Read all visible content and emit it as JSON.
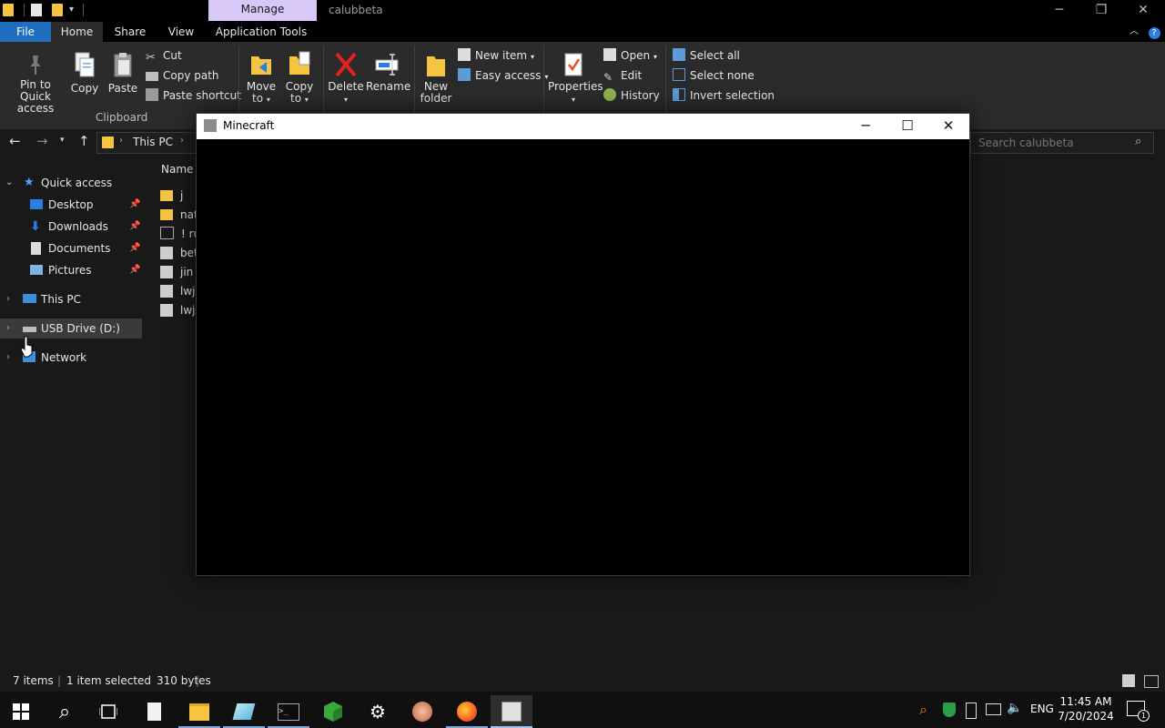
{
  "titlebar": {
    "manage_tab": "Manage",
    "window_title": "calubbeta"
  },
  "tabs": {
    "file": "File",
    "home": "Home",
    "share": "Share",
    "view": "View",
    "application_tools": "Application Tools"
  },
  "ribbon": {
    "pin_to_quick_access_line1": "Pin to Quick",
    "pin_to_quick_access_line2": "access",
    "copy": "Copy",
    "paste": "Paste",
    "cut": "Cut",
    "copy_path": "Copy path",
    "paste_shortcut": "Paste shortcut",
    "clipboard_group": "Clipboard",
    "move_to_line1": "Move",
    "move_to_line2": "to",
    "copy_to_line1": "Copy",
    "copy_to_line2": "to",
    "delete": "Delete",
    "rename": "Rename",
    "new_folder_line1": "New",
    "new_folder_line2": "folder",
    "new_item": "New item",
    "easy_access": "Easy access",
    "properties": "Properties",
    "open": "Open",
    "edit": "Edit",
    "history": "History",
    "select_all": "Select all",
    "select_none": "Select none",
    "invert_selection": "Invert selection"
  },
  "address": {
    "this_pc": "This PC",
    "search_placeholder": "Search calubbeta"
  },
  "nav": {
    "quick_access": "Quick access",
    "desktop": "Desktop",
    "downloads": "Downloads",
    "documents": "Documents",
    "pictures": "Pictures",
    "this_pc": "This PC",
    "usb_drive": "USB Drive (D:)",
    "network": "Network"
  },
  "filelist": {
    "name_header": "Name",
    "rows": [
      "j",
      "nat",
      "! ru",
      "bet",
      "jin",
      "lwj",
      "lwj"
    ]
  },
  "statusbar": {
    "items": "7 items",
    "selected": "1 item selected",
    "size": "310 bytes"
  },
  "minecraft": {
    "title": "Minecraft"
  },
  "tray": {
    "lang": "ENG",
    "time": "11:45 AM",
    "date": "7/20/2024",
    "notifications_count": "1"
  },
  "colors": {
    "accent": "#1f6dbf",
    "manage_tab": "#d8c8f8",
    "folder": "#f5c542"
  }
}
